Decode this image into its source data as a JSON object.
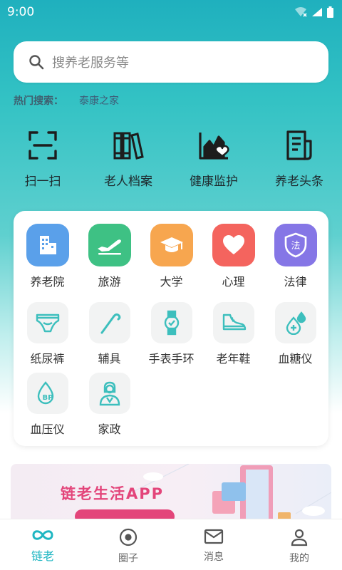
{
  "status": {
    "time": "9:00"
  },
  "search": {
    "placeholder": "搜养老服务等"
  },
  "hot_search": {
    "label": "热门搜索：",
    "items": [
      "泰康之家"
    ]
  },
  "quick_actions": [
    {
      "label": "扫一扫",
      "icon": "scan-icon"
    },
    {
      "label": "老人档案",
      "icon": "archive-books-icon"
    },
    {
      "label": "健康监护",
      "icon": "health-chart-icon"
    },
    {
      "label": "养老头条",
      "icon": "news-document-icon"
    }
  ],
  "services": [
    {
      "label": "养老院",
      "icon": "building-icon",
      "color": "#5aa0ea"
    },
    {
      "label": "旅游",
      "icon": "airplane-icon",
      "color": "#3ec184"
    },
    {
      "label": "大学",
      "icon": "graduation-cap-icon",
      "color": "#f7a64f"
    },
    {
      "label": "心理",
      "icon": "heart-icon",
      "color": "#f4645e"
    },
    {
      "label": "法律",
      "icon": "law-shield-icon",
      "color": "#8576e6"
    }
  ],
  "products": [
    {
      "label": "纸尿裤",
      "icon": "diaper-icon"
    },
    {
      "label": "辅具",
      "icon": "cane-icon"
    },
    {
      "label": "手表手环",
      "icon": "watch-icon"
    },
    {
      "label": "老年鞋",
      "icon": "shoe-icon"
    },
    {
      "label": "血糖仪",
      "icon": "blood-glucose-icon"
    },
    {
      "label": "血压仪",
      "icon": "blood-pressure-icon"
    },
    {
      "label": "家政",
      "icon": "housekeeper-icon"
    }
  ],
  "banner": {
    "title": "链老生活APP"
  },
  "tabs": [
    {
      "label": "链老",
      "icon": "infinity-icon",
      "active": true
    },
    {
      "label": "圈子",
      "icon": "circle-dot-icon",
      "active": false
    },
    {
      "label": "消息",
      "icon": "mail-icon",
      "active": false
    },
    {
      "label": "我的",
      "icon": "user-icon",
      "active": false
    }
  ],
  "colors": {
    "accent": "#1fb6c2",
    "icon_teal": "#3dbfbd"
  }
}
